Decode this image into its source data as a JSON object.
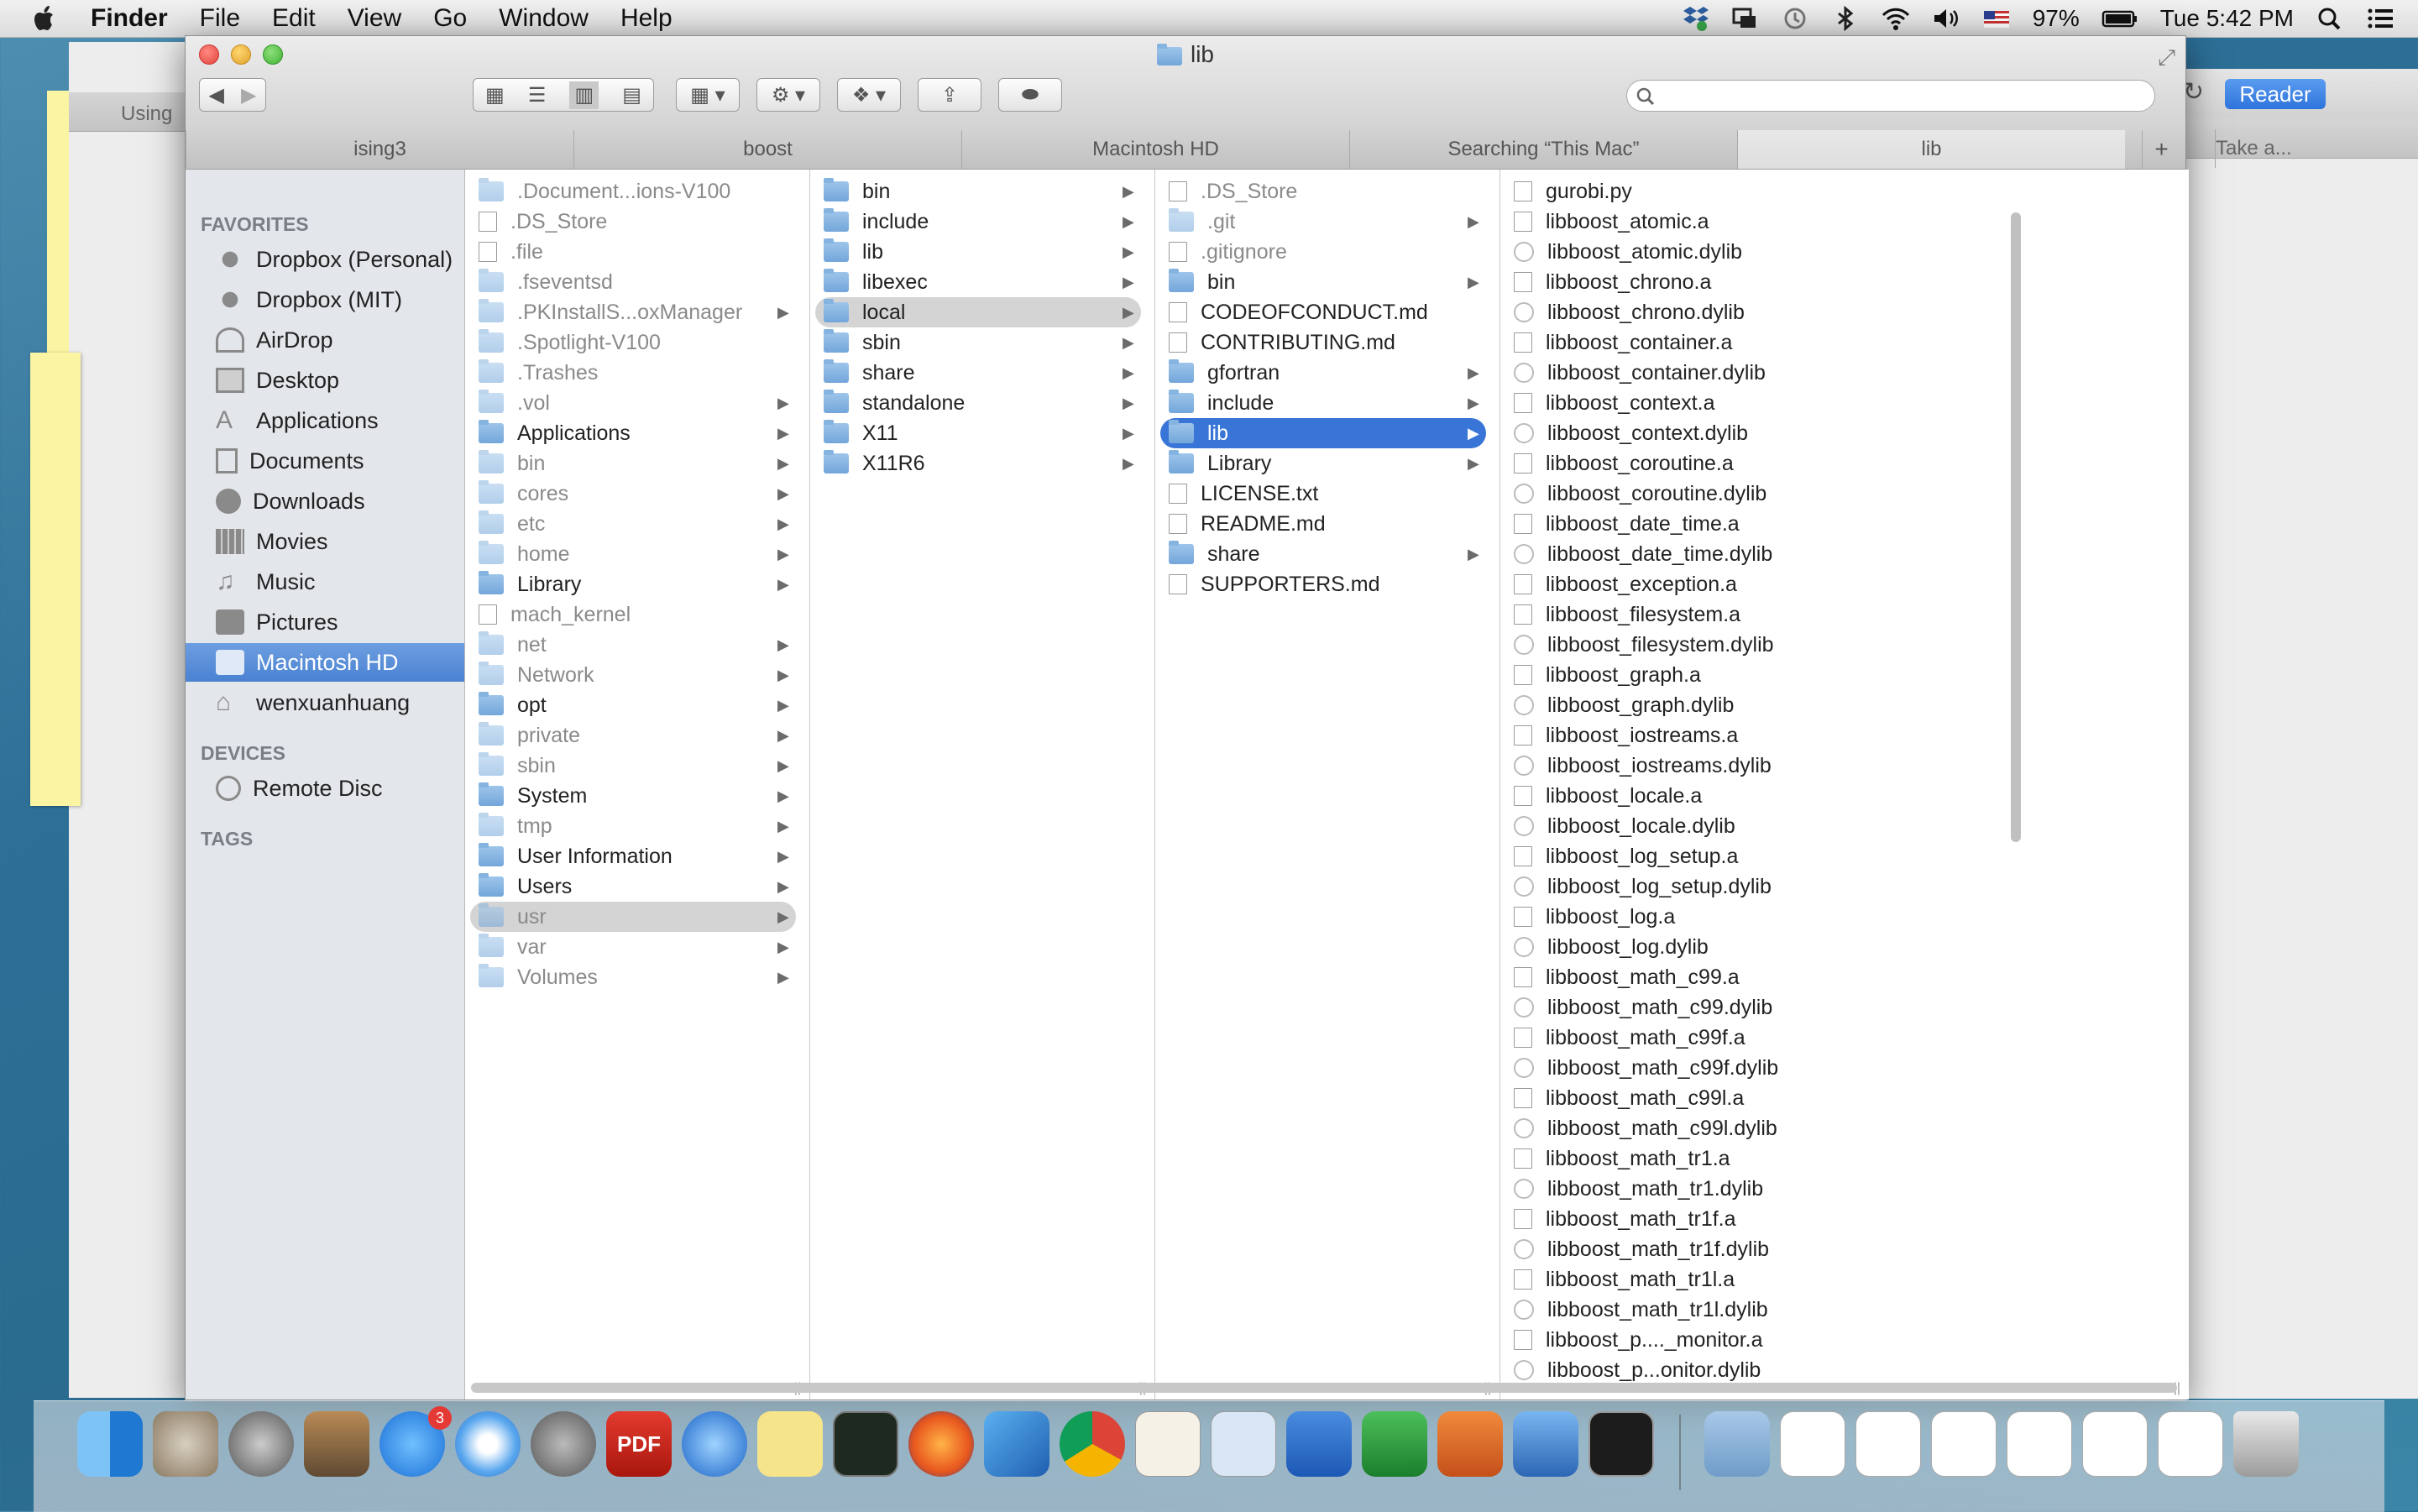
{
  "menubar": {
    "app": "Finder",
    "items": [
      "File",
      "Edit",
      "View",
      "Go",
      "Window",
      "Help"
    ],
    "battery": "97%",
    "clock": "Tue 5:42 PM"
  },
  "bg_window": {
    "left_tab": "Using",
    "reader": "Reader",
    "right_tab": "Take a..."
  },
  "window": {
    "title": "lib",
    "tabs": [
      "ising3",
      "boost",
      "Macintosh HD",
      "Searching “This Mac”",
      "lib"
    ],
    "add_tab": "+"
  },
  "sidebar": {
    "favorites_heading": "FAVORITES",
    "favorites": [
      "Dropbox (Personal)",
      "Dropbox (MIT)",
      "AirDrop",
      "Desktop",
      "Applications",
      "Documents",
      "Downloads",
      "Movies",
      "Music",
      "Pictures",
      "Macintosh HD",
      "wenxuanhuang"
    ],
    "devices_heading": "DEVICES",
    "devices": [
      "Remote Disc"
    ],
    "tags_heading": "TAGS"
  },
  "columns": {
    "col1": [
      ".Document...ions-V100",
      ".DS_Store",
      ".file",
      ".fseventsd",
      ".PKInstallS...oxManager",
      ".Spotlight-V100",
      ".Trashes",
      ".vol",
      "Applications",
      "bin",
      "cores",
      "etc",
      "home",
      "Library",
      "mach_kernel",
      "net",
      "Network",
      "opt",
      "private",
      "sbin",
      "System",
      "tmp",
      "User Information",
      "Users",
      "usr",
      "var",
      "Volumes"
    ],
    "col2": [
      "bin",
      "include",
      "lib",
      "libexec",
      "local",
      "sbin",
      "share",
      "standalone",
      "X11",
      "X11R6"
    ],
    "col3": [
      ".DS_Store",
      ".git",
      ".gitignore",
      "bin",
      "CODEOFCONDUCT.md",
      "CONTRIBUTING.md",
      "gfortran",
      "include",
      "lib",
      "Library",
      "LICENSE.txt",
      "README.md",
      "share",
      "SUPPORTERS.md"
    ],
    "col4": [
      "gurobi.py",
      "libboost_atomic.a",
      "libboost_atomic.dylib",
      "libboost_chrono.a",
      "libboost_chrono.dylib",
      "libboost_container.a",
      "libboost_container.dylib",
      "libboost_context.a",
      "libboost_context.dylib",
      "libboost_coroutine.a",
      "libboost_coroutine.dylib",
      "libboost_date_time.a",
      "libboost_date_time.dylib",
      "libboost_exception.a",
      "libboost_filesystem.a",
      "libboost_filesystem.dylib",
      "libboost_graph.a",
      "libboost_graph.dylib",
      "libboost_iostreams.a",
      "libboost_iostreams.dylib",
      "libboost_locale.a",
      "libboost_locale.dylib",
      "libboost_log_setup.a",
      "libboost_log_setup.dylib",
      "libboost_log.a",
      "libboost_log.dylib",
      "libboost_math_c99.a",
      "libboost_math_c99.dylib",
      "libboost_math_c99f.a",
      "libboost_math_c99f.dylib",
      "libboost_math_c99l.a",
      "libboost_math_c99l.dylib",
      "libboost_math_tr1.a",
      "libboost_math_tr1.dylib",
      "libboost_math_tr1f.a",
      "libboost_math_tr1f.dylib",
      "libboost_math_tr1l.a",
      "libboost_math_tr1l.dylib",
      "libboost_p...._monitor.a",
      "libboost_p...onitor.dylib"
    ]
  },
  "dock": {
    "app_store_badge": "3",
    "pdf_label": "PDF"
  },
  "colors": {
    "selection_blue": "#3875d7",
    "sidebar_selected": "#4a82d2",
    "desktop": "#2d6f97"
  }
}
